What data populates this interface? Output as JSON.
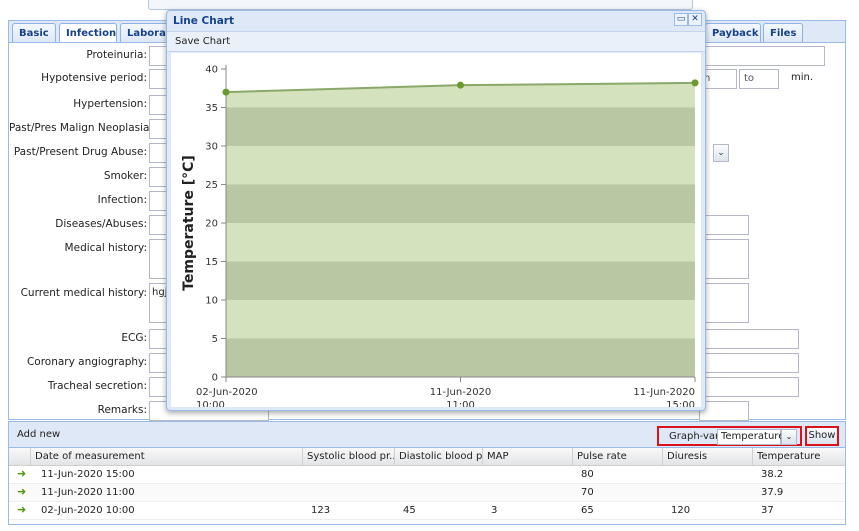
{
  "tabs": [
    "Basic",
    "Infection",
    "Laborato",
    "Payback",
    "Files"
  ],
  "form": {
    "fields": [
      {
        "label": "Proteinuria:",
        "value": ""
      },
      {
        "label": "Hypotensive period:",
        "value": ""
      },
      {
        "label": "Hypertension:",
        "value": ""
      },
      {
        "label": "Past/Pres Malign Neoplasia:",
        "value": ""
      },
      {
        "label": "Past/Present Drug Abuse:",
        "value": ""
      },
      {
        "label": "Smoker:",
        "value": ""
      },
      {
        "label": "Infection:",
        "value": ""
      },
      {
        "label": "Diseases/Abuses:",
        "value": ""
      },
      {
        "label": "Medical history:",
        "value": ""
      },
      {
        "label": "Current medical history:",
        "value": "hgjt"
      },
      {
        "label": "ECG:",
        "value": ""
      },
      {
        "label": "Coronary angiography:",
        "value": ""
      },
      {
        "label": "Tracheal secretion:",
        "value": ""
      },
      {
        "label": "Remarks:",
        "value": ""
      }
    ],
    "hypotensive_unit_left": "n",
    "hypotensive_to_placeholder": "to",
    "hypotensive_unit": "min."
  },
  "chart_window": {
    "title": "Line Chart",
    "save_label": "Save Chart"
  },
  "chart_data": {
    "type": "area",
    "ylabel": "Temperature [°C]",
    "ylim": [
      0,
      40
    ],
    "yticks": [
      0,
      5,
      10,
      15,
      20,
      25,
      30,
      35,
      40
    ],
    "x": [
      "02-Jun-2020 10:00",
      "11-Jun-2020 11:00",
      "11-Jun-2020 15:00"
    ],
    "xtick_dates": [
      "02-Jun-2020",
      "11-Jun-2020",
      "11-Jun-2020"
    ],
    "xtick_times": [
      "10:00",
      "11:00",
      "15:00"
    ],
    "series": [
      {
        "values": [
          37,
          37.9,
          38.2
        ]
      }
    ],
    "grid": true,
    "colors": {
      "line": "#8aa86a",
      "point": "#6b9a2c",
      "fill_light": "#d4e2bd",
      "fill_dark": "#b9c8a3"
    }
  },
  "grid": {
    "add_new_label": "Add new",
    "graph_var_label": "Graph-var.:",
    "graph_var_value": "Temperature",
    "show_label": "Show",
    "columns": [
      "Date of measurement",
      "Systolic blood pr...",
      "Diastolic blood pr...",
      "MAP",
      "Pulse rate",
      "Diuresis",
      "Temperature"
    ],
    "rows": [
      [
        "11-Jun-2020 15:00",
        "",
        "",
        "",
        "80",
        "",
        "38.2"
      ],
      [
        "11-Jun-2020 11:00",
        "",
        "",
        "",
        "70",
        "",
        "37.9"
      ],
      [
        "02-Jun-2020 10:00",
        "123",
        "45",
        "3",
        "65",
        "120",
        "37"
      ]
    ]
  },
  "icons": {
    "row_arrow": "green-arrow-icon",
    "minimize": "minimize-icon",
    "close": "close-icon"
  }
}
